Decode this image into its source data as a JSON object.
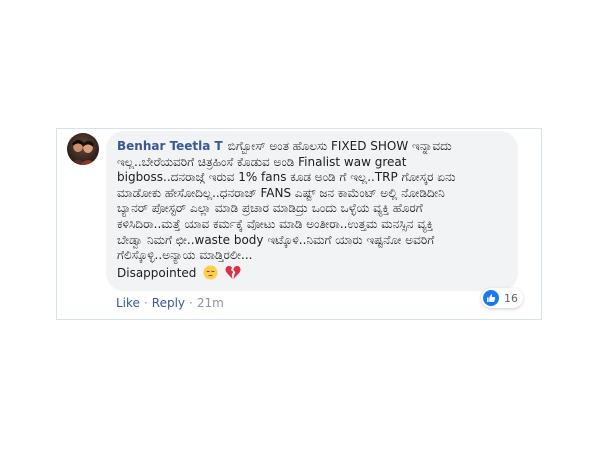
{
  "comment": {
    "author": "Benhar Teetla T",
    "lines": [
      "ಬಿಗ್ಬೋಸ್ ಅಂತ ಹೊಲಸು FIXED SHOW ಇನ್ನಾವದು",
      "ಇಲ್ಲ..ಬೇರೆಯವರಿಗೆ ಚಿತ್ರಹಿಂಸೆ ಕೊಡುವ ಅಂಡಿ Finalist waw great",
      "bigboss..ದನರಾಜ್ಗೆ ಇರುವ 1% fans ಕೂಡ ಅಂಡಿ ಗೆ ಇಲ್ಲ..TRP ಗೋಸ್ಕರ ಏನು",
      "ಮಾಡೋಕು ಹೇಸೋದಿಲ್ಲ..ಧನರಾಜ್ FANS ಎಷ್ಟ್ ಜನ ಕಾಮೆಂಟ್ ಅಲ್ಲಿ ನೋಡಿದೀನಿ",
      "ಬ್ಯಾನರ್ ಪೋಸ್ಟರ್ ಎಲ್ಲಾ ಮಾಡಿ ಪ್ರಚಾರ ಮಾಡಿದ್ರು ಒಂದು ಒಳ್ಳೆಯ ವ್ಯಕ್ತಿ ಹೊರಗೆ",
      "ಕಳಿಸಿದಿರಾ..ಮತ್ತೆ ಯಾವ ಕರ್ಮಕ್ಕೆ ವೋಟು ಮಾಡಿ ಅಂತೀರಾ..ಉತ್ತಮ ಮನಸ್ಸಿನ ವ್ಯಕ್ತಿ",
      "ಬೇಡ್ವಾ ನಿಮಗೆ ಛೀ..waste body ಇಟ್ಕೊಳಿ..ನಿಮಗೆ ಯಾರು ಇಷ್ಟನೋ ಅವರಿಗೆ",
      "ಗೆಲಿಸ್ಕೊಳ್ಳಿ..ಅನ್ಯಾಯ ಮಾಡ್ತಿರಲೀ..."
    ],
    "closing": "Disappointed",
    "closing_emojis": [
      "pensive-face-emoji",
      "broken-heart-emoji"
    ]
  },
  "actions": {
    "like": "Like",
    "reply": "Reply",
    "separator": "·",
    "timestamp": "21m"
  },
  "reactions": {
    "icon": "thumbs-up-icon",
    "count": "16",
    "color": "#1877f2"
  },
  "colors": {
    "author": "#385898",
    "bubble": "#f2f3f5",
    "border": "#d6e2ee"
  }
}
